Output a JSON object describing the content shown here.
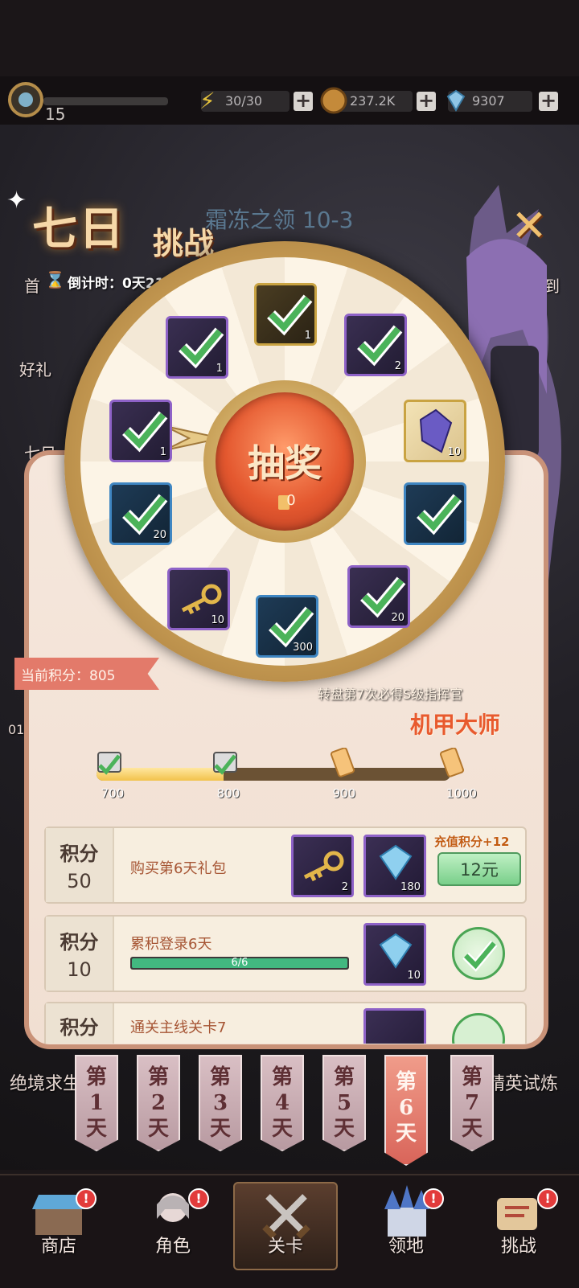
{
  "status_bar": {
    "level": "15",
    "energy": "30/30",
    "gold": "237.2K",
    "diamonds": "9307"
  },
  "background": {
    "stage_title": "霜冻之领 10-3",
    "side_labels": [
      "首",
      "好礼",
      "七日",
      "01"
    ],
    "right_label": "到",
    "bottom_left": "绝境求生",
    "bottom_right": "精英试炼"
  },
  "event": {
    "title_big": "七日",
    "title_small": "挑战",
    "countdown": "倒计时：0天21时30分"
  },
  "wheel": {
    "draw_label": "抽奖",
    "ticket_count": "0",
    "items": [
      {
        "name": "hero-card",
        "count": "1",
        "claimed": true
      },
      {
        "name": "coin",
        "count": "2",
        "claimed": true
      },
      {
        "name": "purple-crystal",
        "count": "10",
        "claimed": false
      },
      {
        "name": "chest",
        "count": "",
        "claimed": true
      },
      {
        "name": "cake",
        "count": "20",
        "claimed": true
      },
      {
        "name": "blue-item",
        "count": "300",
        "claimed": true
      },
      {
        "name": "key",
        "count": "10",
        "claimed": false
      },
      {
        "name": "green-chest",
        "count": "20",
        "claimed": true
      },
      {
        "name": "hero-card-2",
        "count": "1",
        "claimed": true
      },
      {
        "name": "ticket",
        "count": "1",
        "claimed": true
      }
    ],
    "hint": "转盘第7次必得S级指挥官",
    "hero_name": "机甲大师"
  },
  "score": {
    "current_label": "当前积分：805",
    "milestones": [
      "700",
      "800",
      "900",
      "1000"
    ],
    "progress_fraction": 0.36
  },
  "tasks": [
    {
      "score_label": "积分",
      "score_value": "50",
      "title": "购买第6天礼包",
      "rewards": [
        {
          "icon": "key",
          "count": "2"
        },
        {
          "icon": "diamond",
          "count": "180"
        }
      ],
      "bonus": "充值积分+12",
      "button": "12元"
    },
    {
      "score_label": "积分",
      "score_value": "10",
      "title": "累积登录6天",
      "progress_text": "6/6",
      "progress": 1.0,
      "rewards": [
        {
          "icon": "diamond",
          "count": "10"
        }
      ]
    },
    {
      "score_label": "积分",
      "score_value": "",
      "title": "通关主线关卡7"
    }
  ],
  "day_tabs": [
    {
      "label": "第1天"
    },
    {
      "label": "第2天"
    },
    {
      "label": "第3天"
    },
    {
      "label": "第4天"
    },
    {
      "label": "第5天"
    },
    {
      "label": "第6天",
      "active": true
    },
    {
      "label": "第7天"
    }
  ],
  "bottom_nav": {
    "shop": "商店",
    "character": "角色",
    "stage": "关卡",
    "territory": "领地",
    "challenge": "挑战"
  },
  "colors": {
    "accent_red": "#e23b3b",
    "panel_bg": "#f5e7dc",
    "check_green": "#4aa554"
  }
}
